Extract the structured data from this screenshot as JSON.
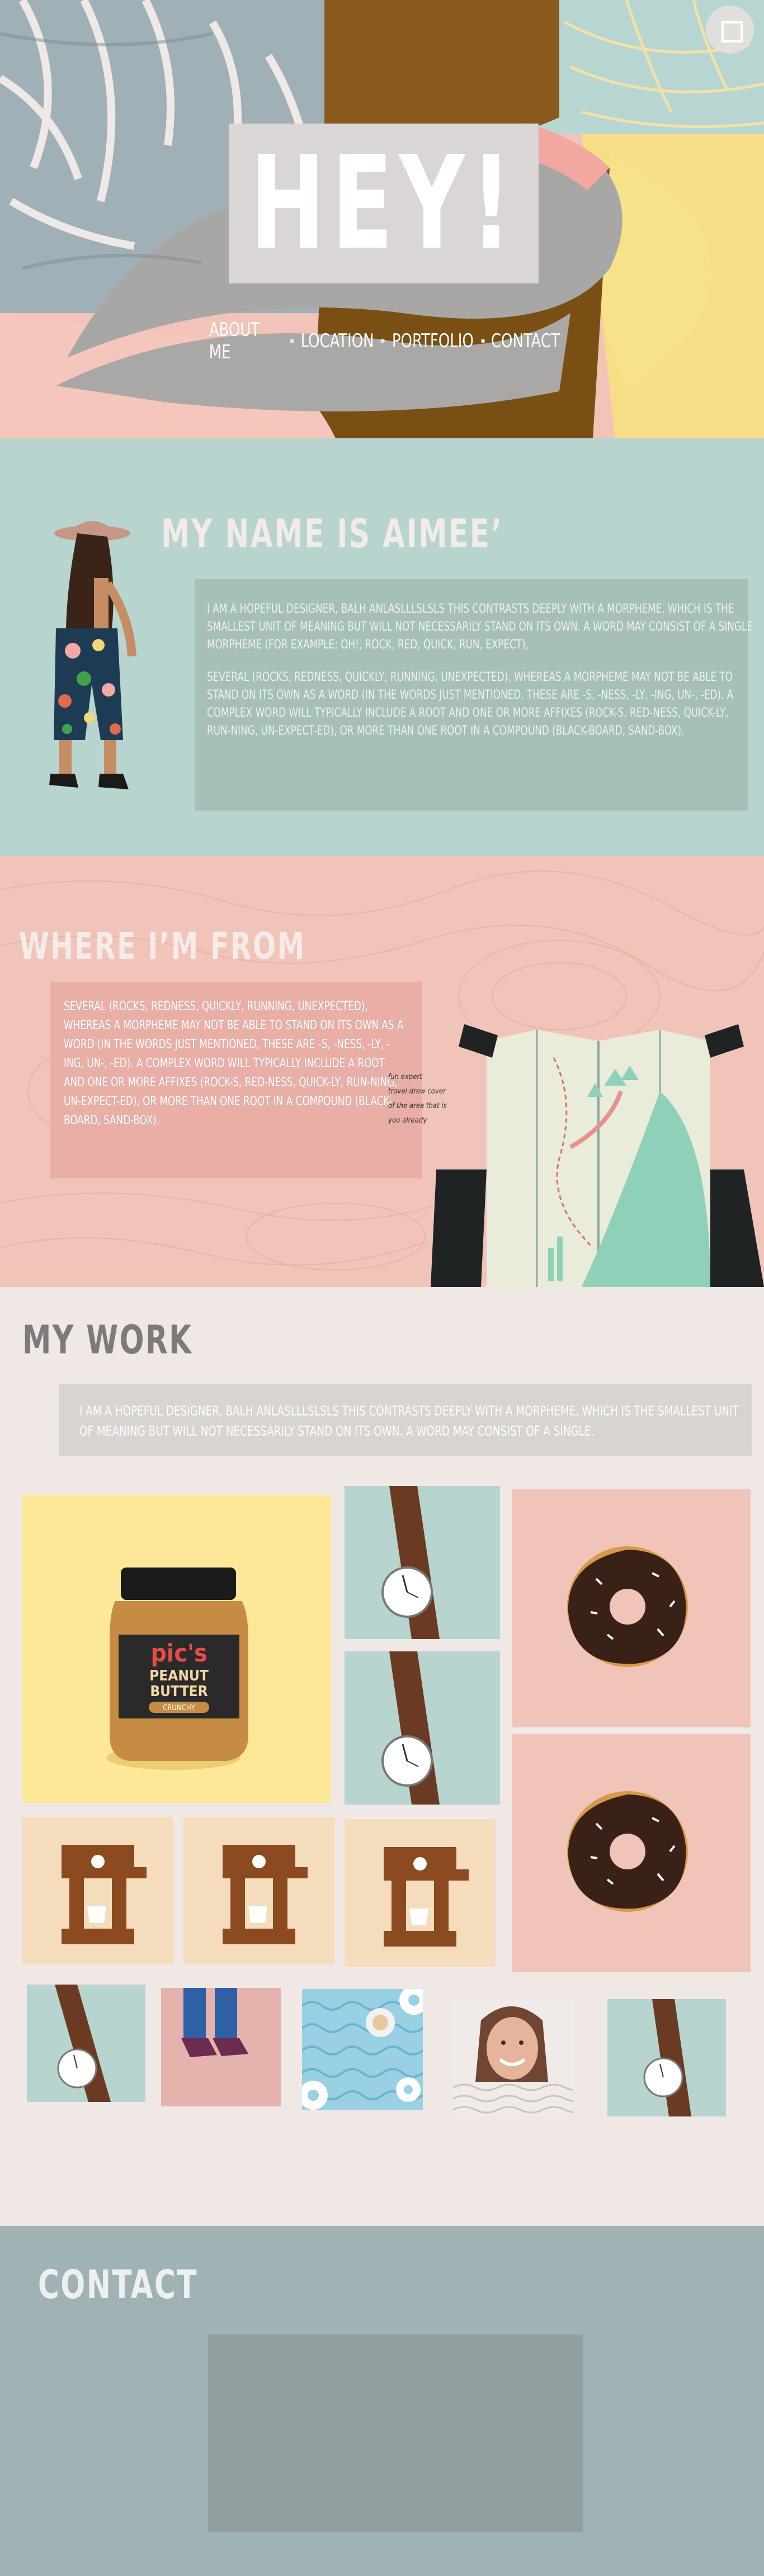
{
  "hero": {
    "title": "HEY!",
    "nav": [
      "ABOUT ME",
      "LOCATION",
      "PORTFOLIO",
      "CONTACT"
    ]
  },
  "about": {
    "title": "MY NAME IS AIMEE’",
    "paragraphs": [
      "I am a hopeful designer, balh anlaslllslsls this contrasts deeply with a morpheme, which is the smallest unit of meaning but will not necessarily stand on its own. A word may consist of a single morpheme (for example: oh!, rock, red, quick, run, expect),",
      "several (rocks, redness, quickly, running, unexpected), whereas a morpheme may not be able to stand on its own as a word (in the words just mentioned, these are -s, -ness, -ly, -ing, un-, -ed). A complex word will typically include a root and one or more affixes (rock-s, red-ness, quick-ly, run-ning, un-expect-ed), or more than one root in a compound (black-board, sand-box)."
    ]
  },
  "from": {
    "title": "WHERE I’M FROM",
    "paragraph": "several (rocks, redness, quickly, running, unexpected), whereas a morpheme may not be able to stand on its own as a word (in the words just mentioned, these are -s, -ness, -ly, -ing, un-, -ed). A complex word will typically include a root and one or more affixes (rock-s, red-ness, quick-ly, run-ning, un-expect-ed), or more than one root in a compound (black-board, sand-box).",
    "map_note": [
      "fun expert",
      "travel drew cover",
      "of the area that is",
      "you already"
    ]
  },
  "work": {
    "title": "MY WORK",
    "paragraph": "I am a hopeful designer, balh anlaslllslsls this contrasts deeply with a morpheme, which is the smallest unit of meaning but will not necessarily stand on its own. A word may consist of a single.",
    "jar": {
      "brand": "pic's",
      "line1": "PEANUT",
      "line2": "BUTTER",
      "line3": "CRUNCHY"
    }
  },
  "contact": {
    "title": "CONTACT"
  },
  "colors": {
    "mint": "#b7d4ce",
    "blush": "#f1c4ba",
    "cream": "#efe8e5",
    "slate": "#9fb2b4"
  }
}
